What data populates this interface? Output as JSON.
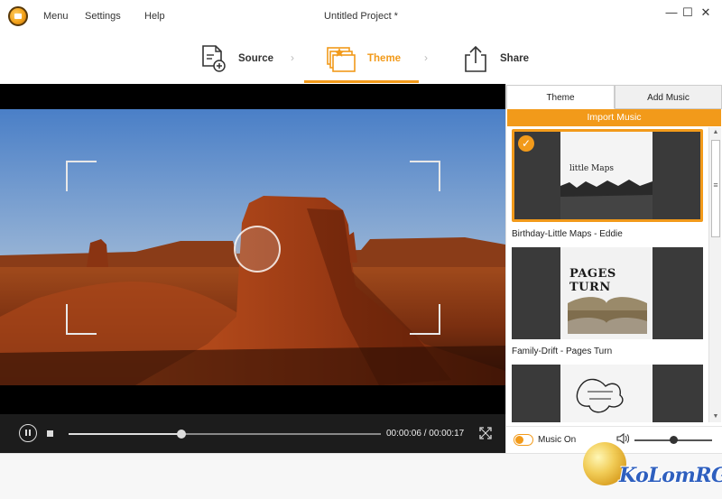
{
  "window": {
    "title": "Untitled Project *",
    "menu": [
      "Menu",
      "Settings",
      "Help"
    ],
    "controls": {
      "minimize": "—",
      "maximize": "☐",
      "close": "✕"
    }
  },
  "steps": [
    {
      "label": "Source",
      "icon": "document-add-icon",
      "active": false
    },
    {
      "label": "Theme",
      "icon": "theme-stack-icon",
      "active": true
    },
    {
      "label": "Share",
      "icon": "share-upload-icon",
      "active": false
    }
  ],
  "player": {
    "time": "00:00:06 / 00:00:17",
    "progress": 0.36
  },
  "panel": {
    "tabs": [
      {
        "label": "Theme",
        "active": true
      },
      {
        "label": "Add Music",
        "active": false
      }
    ],
    "import_label": "Import Music",
    "themes": [
      {
        "name": "Birthday-Little Maps - Eddie",
        "thumb_text": "little Maps",
        "selected": true
      },
      {
        "name": "Family-Drift - Pages Turn",
        "thumb_text": "PAGES TURN",
        "selected": false
      },
      {
        "name": "",
        "thumb_text": "",
        "selected": false
      }
    ],
    "music_label": "Music On",
    "music_on": true,
    "volume": 0.5
  },
  "watermark": "KoLomRG",
  "colors": {
    "accent": "#f29a1a"
  }
}
